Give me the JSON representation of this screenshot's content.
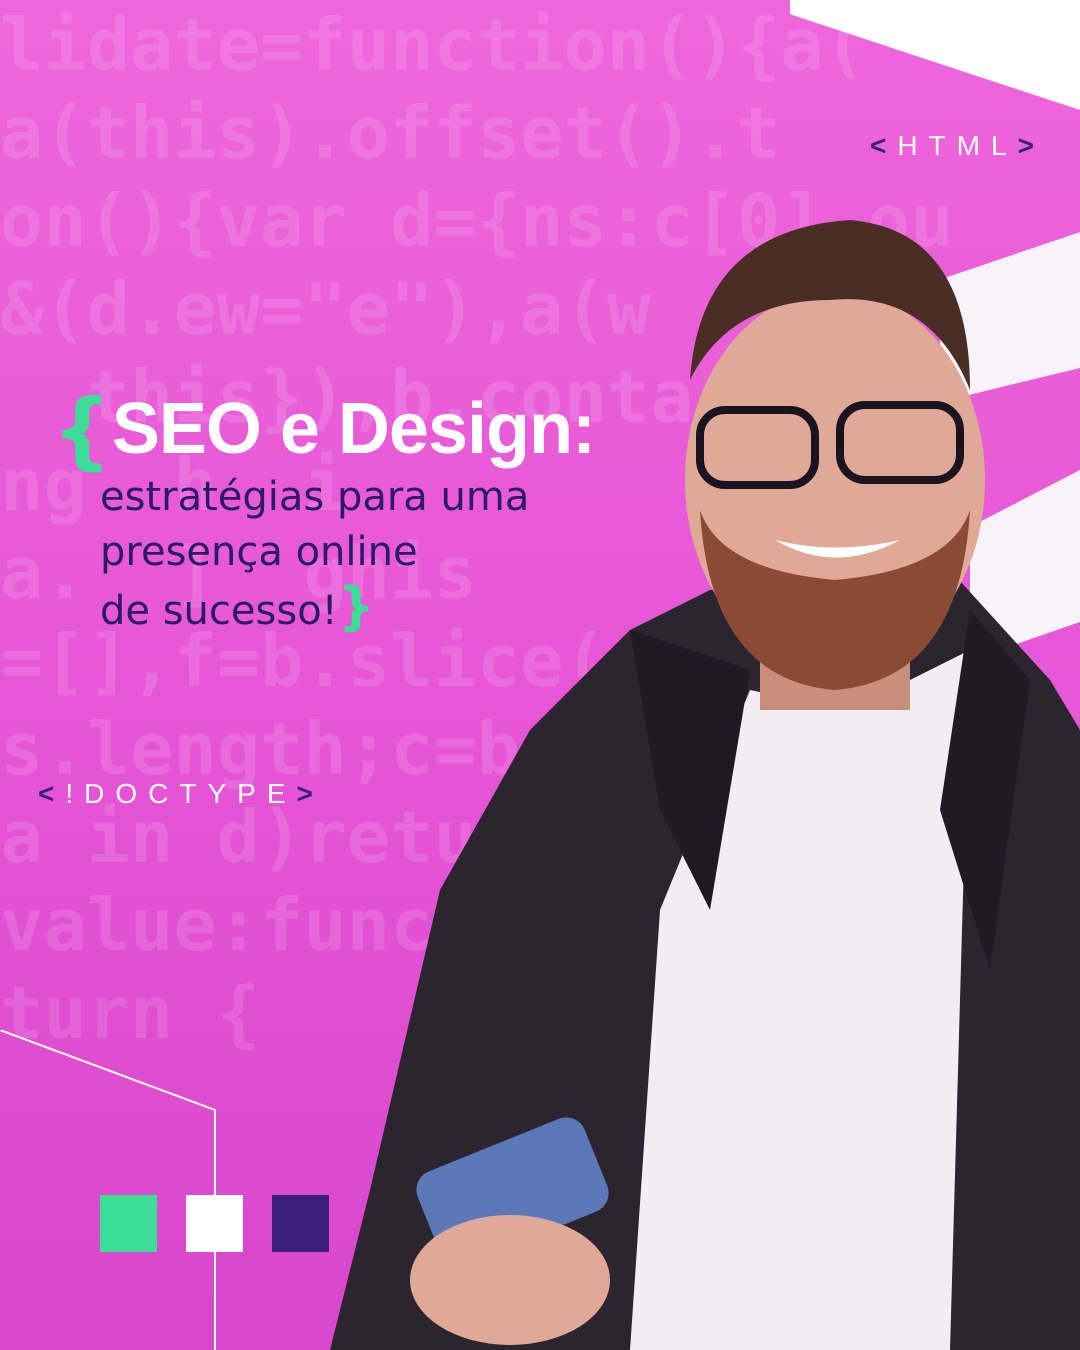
{
  "background_code": {
    "lines": [
      "lidate=function(){a(",
      "a(this).offset().t",
      "on(){var d={ns:c[0].ou",
      "&(d.ew=\"e\"),a(w",
      "  this}),b.conta",
      "ng  h  i",
      "a.  ]  ghis",
      "=[],f=b.slice(",
      "s.length;c=b",
      "a in d)retu",
      "value:func",
      "turn {"
    ]
  },
  "tags": {
    "html": "HTML",
    "doctype": "!DOCTYPE",
    "open": "<",
    "close": ">"
  },
  "headline": {
    "brace_open": "{",
    "title": "SEO e Design:",
    "subtitle_lines": [
      "estratégias para uma",
      "presença online",
      "de sucesso!"
    ],
    "brace_close": "}"
  },
  "colors": {
    "pink": "#e95fd6",
    "green": "#3ddc97",
    "white": "#ffffff",
    "purple": "#3b1f7a"
  },
  "swatches": [
    "#3ddc97",
    "#ffffff",
    "#3b1f7a"
  ]
}
